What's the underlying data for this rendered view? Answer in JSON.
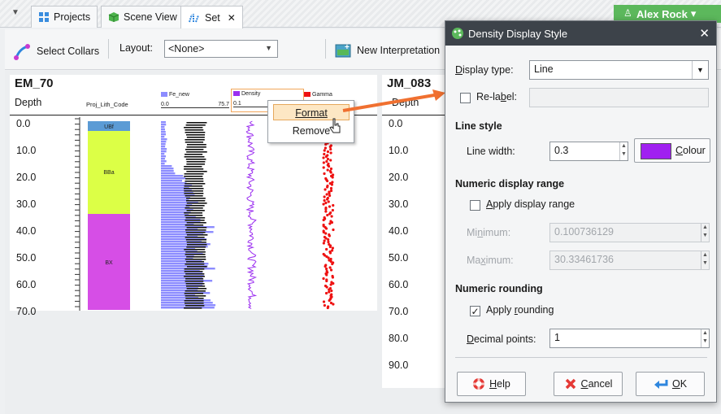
{
  "tabs": [
    {
      "label": "Projects",
      "icon": "projects-icon"
    },
    {
      "label": "Scene View",
      "icon": "scene-view-icon"
    },
    {
      "label": "Set",
      "icon": "set-icon",
      "close": "✕"
    }
  ],
  "user": {
    "name": "Alex Rock",
    "caret": "▾"
  },
  "toolbar": {
    "select_collars": "Select Collars",
    "layout_label": "Layout:",
    "layout_value": "<None>",
    "new_interpretation": "New Interpretation"
  },
  "logs": [
    {
      "title": "EM_70",
      "depth_header": "Depth",
      "depth_labels": [
        "0.0",
        "10.0",
        "20.0",
        "30.0",
        "40.0",
        "50.0",
        "60.0",
        "70.0"
      ],
      "lith_header": "Proj_Lith_Code",
      "lith_units": [
        {
          "code": "UBf",
          "color": "#5b9bd5"
        },
        {
          "code": "BBa",
          "color": "#dcff46"
        },
        {
          "code": "BX",
          "color": "#d64ee6"
        }
      ],
      "columns": [
        {
          "name": "Fe_new",
          "color": "#8c8cff",
          "min": "0.0",
          "max": "75.7"
        },
        {
          "name": "Density",
          "color": "#9b2ef0",
          "min": "0.1",
          "max": ""
        },
        {
          "name": "Gamma",
          "color": "#ee1111",
          "min": "",
          "max": "43.2"
        }
      ]
    },
    {
      "title": "JM_083",
      "depth_header": "Depth",
      "depth_labels": [
        "0.0",
        "10.0",
        "20.0",
        "30.0",
        "40.0",
        "50.0",
        "60.0",
        "70.0",
        "80.0",
        "90.0"
      ]
    }
  ],
  "context_menu": {
    "items": [
      "Format",
      "Remove"
    ],
    "highlighted": "Format"
  },
  "dialog": {
    "title": "Density Display Style",
    "close": "✕",
    "display_type_label": "Display type:",
    "display_type_value": "Line",
    "relabel_label": "Re-label:",
    "relabel_value": "",
    "line_style_header": "Line style",
    "line_width_label": "Line width:",
    "line_width_value": "0.3",
    "colour_label": "Colour",
    "colour": "#a020f0",
    "numeric_range_header": "Numeric display range",
    "apply_range_label": "Apply display range",
    "minimum_label": "Minimum:",
    "minimum_value": "0.100736129",
    "maximum_label": "Maximum:",
    "maximum_value": "30.33461736",
    "numeric_rounding_header": "Numeric rounding",
    "apply_rounding_label": "Apply rounding",
    "decimal_points_label": "Decimal points:",
    "decimal_points_value": "1",
    "help_label": "Help",
    "cancel_label": "Cancel",
    "ok_label": "OK"
  },
  "colors": {
    "accent_arrow": "#f07030",
    "user_badge": "#5cb85c",
    "titlebar": "#3d434a"
  }
}
